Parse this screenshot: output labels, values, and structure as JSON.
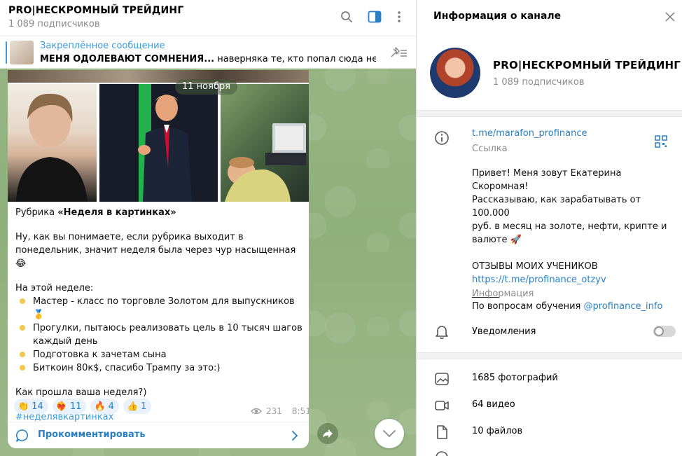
{
  "chat": {
    "title": "PRO|НЕСКРОМНЫЙ ТРЕЙДИНГ",
    "subscribers": "1 089 подписчиков"
  },
  "pinned": {
    "label": "Закреплённое сообщение",
    "bold": "МЕНЯ ОДОЛЕВАЮТ СОМНЕНИЯ...",
    "text": " наверняка те, кто попал сюда недавно ..."
  },
  "message": {
    "date": "11 ноября",
    "rubric_prefix": "Рубрика ",
    "rubric_name": "«Неделя в картинках»",
    "para1": "Ну, как вы понимаете, если рубрика выходит в понедельник, значит неделя была через чур насыщенная😂",
    "week_intro": "На этой неделе:",
    "bullets": [
      "Мастер - класс по торговле Золотом для выпускников 🥇",
      "Прогулки, пытаюсь реализовать цель в 10 тысяч шагов каждый день",
      "Подготовка к зачетам сына",
      "Биткоин 80к$, спасибо Трампу за это:)"
    ],
    "question": "Как прошла ваша неделя?)",
    "hashtag": "#неделявкартинках",
    "reactions": [
      {
        "emoji": "👏",
        "count": "14"
      },
      {
        "emoji": "❤️‍🔥",
        "count": "11"
      },
      {
        "emoji": "🔥",
        "count": "4"
      },
      {
        "emoji": "👍",
        "count": "1"
      }
    ],
    "views": "231",
    "time": "8:51",
    "comment_label": "Прокомментировать"
  },
  "info": {
    "title": "Информация о канале",
    "name": "PRO|НЕСКРОМНЫЙ ТРЕЙДИНГ",
    "subscribers": "1 089 подписчиков",
    "link": "t.me/marafon_profinance",
    "link_sub": "Ссылка",
    "desc_lines": [
      "Привет! Меня зовут Екатерина Скоромная!",
      "Рассказываю, как зарабатывать от 100.000",
      "руб. в месяц на золоте, нефти, крипте и",
      "валюте 🚀"
    ],
    "reviews_title": "ОТЗЫВЫ МОИХ УЧЕНИКОВ",
    "reviews_link": "https://t.me/profinance_otzyv",
    "separator": "______",
    "contact_prefix": "По вопросам обучения ",
    "contact_handle": "@profinance_info",
    "desc_sub": "Информация",
    "notifications": "Уведомления",
    "stats": [
      "1685 фотографий",
      "64 видео",
      "10 файлов"
    ]
  },
  "colors": {
    "accent": "#2b7fc4",
    "link": "#3a9bd9",
    "chat_bg": "#98b484"
  }
}
